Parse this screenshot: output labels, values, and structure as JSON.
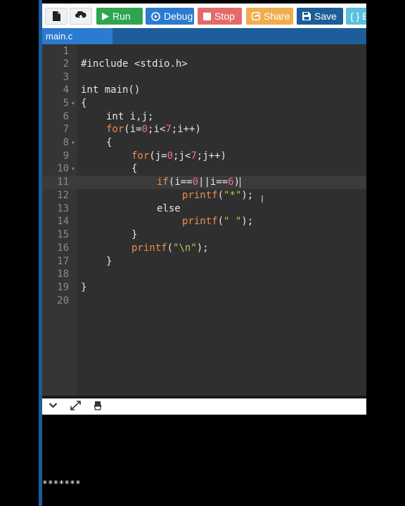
{
  "toolbar": {
    "run": "Run",
    "debug": "Debug",
    "stop": "Stop",
    "share": "Share",
    "save": "Save",
    "beautify": "{ } B",
    "colors": {
      "run": "#2ea44f",
      "debug": "#2b7bd0",
      "stop": "#e46a6a",
      "share": "#f0ad4e",
      "save": "#1c5d9a",
      "beautify": "#5bc0de"
    }
  },
  "tabs": [
    "main.c"
  ],
  "editor": {
    "line_numbers": [
      "1",
      "2",
      "3",
      "4",
      "5",
      "6",
      "7",
      "8",
      "9",
      "10",
      "11",
      "12",
      "13",
      "14",
      "15",
      "16",
      "17",
      "18",
      "19",
      "20"
    ],
    "lines": {
      "l2": "#include <stdio.h>",
      "l4": "int main()",
      "l5": "{",
      "l6": "int i,j;",
      "l7_kw": "for",
      "l7_a": "(i=",
      "l7_n0": "0",
      "l7_b": ";i<",
      "l7_n7": "7",
      "l7_c": ";i++)",
      "l8": "{",
      "l9_kw": "for",
      "l9_a": "(j=",
      "l9_n0": "0",
      "l9_b": ";j<",
      "l9_n7": "7",
      "l9_c": ";j++)",
      "l10": "{",
      "l11_kw": "if",
      "l11_a": "(i==",
      "l11_n0": "0",
      "l11_b": "||i==",
      "l11_n6": "6",
      "l11_c": ")",
      "l12_fn": "printf",
      "l12_a": "(",
      "l12_str": "\"*\"",
      "l12_b": ");",
      "l13": "else",
      "l14_fn": "printf",
      "l14_a": "(",
      "l14_str": "\" \"",
      "l14_b": ");",
      "l15": "}",
      "l16_fn": "printf",
      "l16_a": "(",
      "l16_str": "\"\\n\"",
      "l16_b": ");",
      "l17": "}",
      "l19": "}"
    }
  },
  "output": {
    "text": "*******"
  },
  "icons": {
    "new_file": "file-icon",
    "upload": "upload-icon",
    "run": "play-icon",
    "debug": "debug-icon",
    "stop": "stop-icon",
    "share": "share-icon",
    "save": "save-icon",
    "collapse": "chevron-down-icon",
    "expand": "expand-icon",
    "clear": "clear-icon"
  }
}
